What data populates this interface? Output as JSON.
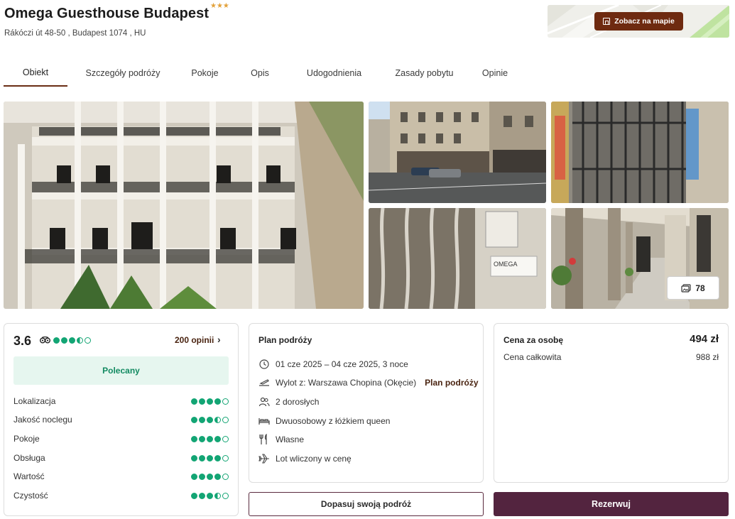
{
  "hotel": {
    "name": "Omega Guesthouse Budapest",
    "stars": 3,
    "address": "Rákóczi út 48-50 , Budapest 1074 , HU"
  },
  "map": {
    "button_label": "Zobacz na mapie"
  },
  "tabs": [
    {
      "label": "Obiekt",
      "active": true
    },
    {
      "label": "Szczegóły podróży",
      "active": false
    },
    {
      "label": "Pokoje",
      "active": false
    },
    {
      "label": "Opis",
      "active": false
    },
    {
      "label": "Udogodnienia",
      "active": false
    },
    {
      "label": "Zasady pobytu",
      "active": false
    },
    {
      "label": "Opinie",
      "active": false
    }
  ],
  "gallery": {
    "photo_count": "78"
  },
  "rating": {
    "score": "3.6",
    "dots": 3.5,
    "reviews_label": "200 opinii",
    "recommendation": "Polecany",
    "categories": [
      {
        "label": "Lokalizacja",
        "dots": 4
      },
      {
        "label": "Jakość noclegu",
        "dots": 3.5
      },
      {
        "label": "Pokoje",
        "dots": 4
      },
      {
        "label": "Obsługa",
        "dots": 4
      },
      {
        "label": "Wartość",
        "dots": 4
      },
      {
        "label": "Czystość",
        "dots": 3.5
      }
    ]
  },
  "plan": {
    "title": "Plan podróży",
    "dates": "01 cze 2025 – 04 cze 2025, 3 noce",
    "departure": "Wylot z: Warszawa Chopina (Okęcie)",
    "departure_link": "Plan podróży",
    "guests": "2 dorosłych",
    "room": "Dwuosobowy z łóżkiem queen",
    "meals": "Własne",
    "flight": "Lot wliczony w cenę"
  },
  "price": {
    "per_person_label": "Cena za osobę",
    "per_person_value": "494 zł",
    "total_label": "Cena całkowita",
    "total_value": "988 zł"
  },
  "buttons": {
    "adjust": "Dopasuj swoją podróż",
    "book": "Rezerwuj"
  },
  "colors": {
    "brand": "#53243f",
    "accent_brown": "#6e2a10",
    "rating_green": "#13a574",
    "stars": "#e2a13a"
  }
}
